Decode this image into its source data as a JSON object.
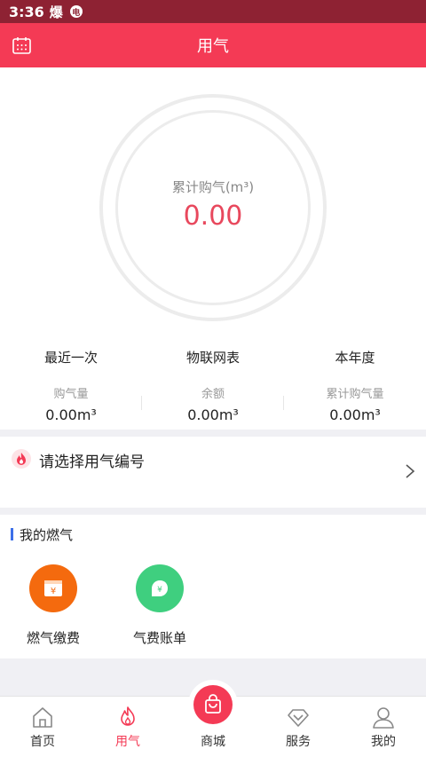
{
  "status_bar": {
    "time": "3:36",
    "icon_glyph": "爆",
    "badge_glyph": "电"
  },
  "header": {
    "title": "用气"
  },
  "ring": {
    "label": "累计购气(m³)",
    "value": "0.00"
  },
  "stats": [
    {
      "title": "最近一次",
      "label": "购气量",
      "value": "0.00m³"
    },
    {
      "title": "物联网表",
      "label": "余额",
      "value": "0.00m³"
    },
    {
      "title": "本年度",
      "label": "累计购气量",
      "value": "0.00m³"
    }
  ],
  "select": {
    "text": "请选择用气编号"
  },
  "my_gas": {
    "title": "我的燃气",
    "items": [
      {
        "label": "燃气缴费",
        "glyph": "¥",
        "color": "#f46a0e",
        "icon": "gas-payment-icon"
      },
      {
        "label": "气费账单",
        "glyph": "¥",
        "color": "#3fcf7f",
        "icon": "gas-bill-icon"
      }
    ]
  },
  "bottom_nav": [
    {
      "label": "首页",
      "icon": "home-icon"
    },
    {
      "label": "用气",
      "icon": "flame-icon"
    },
    {
      "label": "商城",
      "icon": "shopping-bag-icon"
    },
    {
      "label": "服务",
      "icon": "diamond-icon"
    },
    {
      "label": "我的",
      "icon": "user-icon"
    }
  ],
  "colors": {
    "primary": "#f43a55",
    "status_bar": "#8e2233",
    "value_red": "#e8485d",
    "accent_blue": "#3d6fe8"
  }
}
